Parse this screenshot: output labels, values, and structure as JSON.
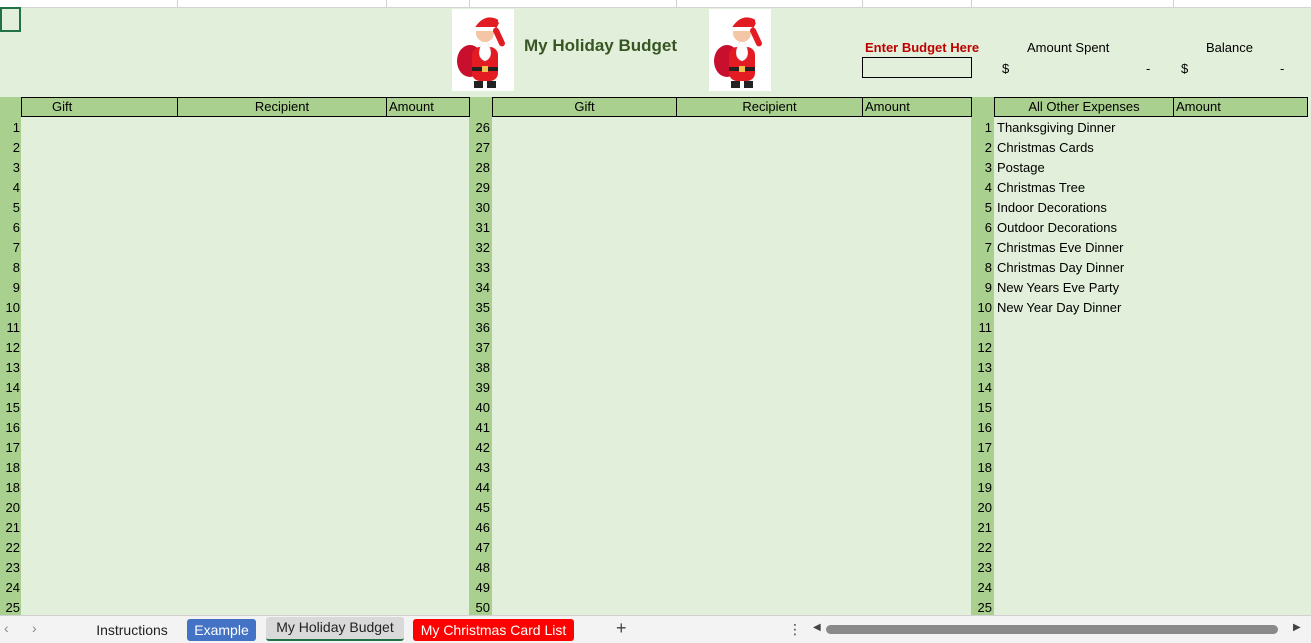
{
  "title": "My Holiday Budget",
  "budget": {
    "label": "Enter Budget Here",
    "value": ""
  },
  "spent": {
    "label": "Amount Spent",
    "currency": "$",
    "value": "-"
  },
  "balance": {
    "label": "Balance",
    "currency": "$",
    "value": "-"
  },
  "gift_table_1": {
    "headers": [
      "Gift",
      "Recipient",
      "Amount"
    ],
    "start": 1,
    "end": 25
  },
  "gift_table_2": {
    "headers": [
      "Gift",
      "Recipient",
      "Amount"
    ],
    "start": 26,
    "end": 50
  },
  "other_expenses": {
    "headers": [
      "All Other Expenses",
      "Amount"
    ],
    "start": 1,
    "end": 25,
    "items": [
      "Thanksgiving Dinner",
      "Christmas Cards",
      "Postage",
      "Christmas Tree",
      "Indoor Decorations",
      "Outdoor Decorations",
      "Christmas Eve Dinner",
      "Christmas Day Dinner",
      "New Years Eve Party",
      "New Year Day Dinner"
    ]
  },
  "sheet_tabs": [
    "Instructions",
    "Example",
    "My Holiday Budget",
    "My Christmas Card List"
  ],
  "icons": {
    "nav_prev": "chevron-left-icon",
    "nav_next": "chevron-right-icon",
    "add_sheet": "plus-icon",
    "more": "vertical-ellipsis-icon",
    "santa": "santa-claus-image"
  },
  "colors": {
    "sheet_bg": "#e2efda",
    "header_fill": "#a9d08e",
    "title_color": "#375623",
    "budget_label_color": "#c00000",
    "example_tab": "#4472c4",
    "card_list_tab": "#ff0000"
  }
}
